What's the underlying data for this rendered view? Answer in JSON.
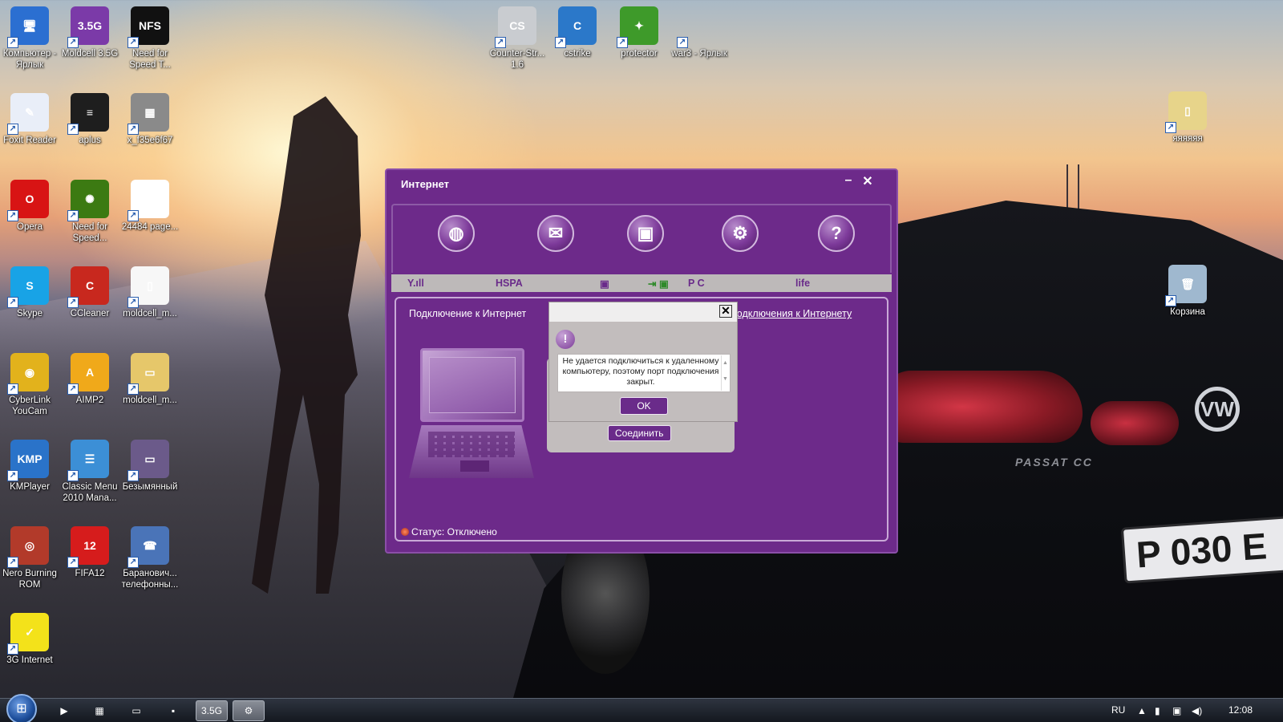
{
  "desktop_icons": [
    {
      "label": "Компьютер - Ярлык",
      "glyph": "🖥",
      "color": "#2b6fd1"
    },
    {
      "label": "Moldcell 3.5G",
      "glyph": "3.5G",
      "color": "#7b3aa8"
    },
    {
      "label": "Need for Speed T...",
      "glyph": "NFS",
      "color": "#111111"
    },
    {
      "label": "Foxit Reader",
      "glyph": "✎",
      "color": "#e9eef8"
    },
    {
      "label": "aplus",
      "glyph": "≡",
      "color": "#1e1e1e"
    },
    {
      "label": "x_f35e6f67",
      "glyph": "▦",
      "color": "#8a8a8a"
    },
    {
      "label": "Opera",
      "glyph": "O",
      "color": "#d81414"
    },
    {
      "label": "Need for Speed...",
      "glyph": "✺",
      "color": "#3c7a12"
    },
    {
      "label": "24484 page...",
      "glyph": "▤",
      "color": "#ffffff"
    },
    {
      "label": "Skype",
      "glyph": "S",
      "color": "#18a3e6"
    },
    {
      "label": "CCleaner",
      "glyph": "C",
      "color": "#c8281e"
    },
    {
      "label": "moldcell_m...",
      "glyph": "▯",
      "color": "#f7f7f7"
    },
    {
      "label": "CyberLink YouCam",
      "glyph": "◉",
      "color": "#e2b21c"
    },
    {
      "label": "AIMP2",
      "glyph": "A",
      "color": "#f0a91a"
    },
    {
      "label": "moldcell_m...",
      "glyph": "▭",
      "color": "#e6c76a"
    },
    {
      "label": "KMPlayer",
      "glyph": "KMP",
      "color": "#2a73c9"
    },
    {
      "label": "Classic Menu 2010 Mana...",
      "glyph": "☰",
      "color": "#3c8fd6"
    },
    {
      "label": "Безымянный",
      "glyph": "▭",
      "color": "#6b5a8a"
    },
    {
      "label": "Nero Burning ROM",
      "glyph": "◎",
      "color": "#b23a2a"
    },
    {
      "label": "FIFA12",
      "glyph": "12",
      "color": "#d61c1c"
    },
    {
      "label": "Баранович... телефонны...",
      "glyph": "☎",
      "color": "#4a74b8"
    },
    {
      "label": "3G Internet",
      "glyph": "✓",
      "color": "#f3e21a"
    }
  ],
  "top_icons": [
    {
      "label": "Counter-Str... 1.6",
      "glyph": "CS",
      "color": "#c9ccd0"
    },
    {
      "label": "cstrike",
      "glyph": "C",
      "color": "#2b78c9"
    },
    {
      "label": "protector",
      "glyph": "✦",
      "color": "#3e9a2a"
    },
    {
      "label": "war3 - Ярлык",
      "glyph": "",
      "color": "transparent"
    }
  ],
  "right_icons": [
    {
      "label": "яяяяяя",
      "glyph": "▯",
      "color": "#e7d48a"
    },
    {
      "label": "Корзина",
      "glyph": "🗑",
      "color": "#9fb8cf"
    }
  ],
  "app": {
    "title": "Интернет",
    "minimize": "–",
    "close": "✕",
    "tools": [
      {
        "name": "internet-globe-icon",
        "glyph": "◍"
      },
      {
        "name": "messages-envelope-icon",
        "glyph": "✉"
      },
      {
        "name": "contacts-book-icon",
        "glyph": "▣"
      },
      {
        "name": "settings-gears-icon",
        "glyph": "⚙"
      },
      {
        "name": "help-question-icon",
        "glyph": "?"
      }
    ],
    "status": {
      "signal": "Y.ıll",
      "network_type": "HSPA",
      "device": "▣",
      "pc_label": "P C",
      "operator": "life"
    },
    "connection_title": "Подключение к Интернет",
    "connection_link": "подключения к Интернету",
    "connect_button": "Соединить",
    "status_text": "Статус: Отключено"
  },
  "dialog": {
    "close": "✕",
    "icon": "!",
    "message": "Не удается подключиться к удаленному компьютеру, поэтому порт подключения закрыт.",
    "ok": "OK"
  },
  "taskbar": {
    "start": "⊞",
    "buttons": [
      {
        "name": "media-player-taskbar-button",
        "glyph": "▶"
      },
      {
        "name": "calendar-taskbar-button",
        "glyph": "▦"
      },
      {
        "name": "explorer-taskbar-button",
        "glyph": "▭"
      },
      {
        "name": "save-taskbar-button",
        "glyph": "▪"
      },
      {
        "name": "moldcell-taskbar-button",
        "glyph": "3.5G"
      },
      {
        "name": "tools-taskbar-button",
        "glyph": "⚙"
      }
    ],
    "lang": "RU",
    "tray_up": "▲",
    "clock": "12:08"
  },
  "scene": {
    "plate": "P 030 E",
    "car_model": "PASSAT CC",
    "logo": "VW"
  }
}
